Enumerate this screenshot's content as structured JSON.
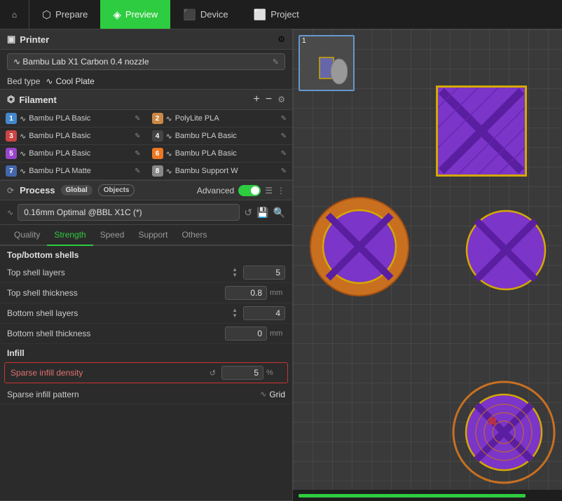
{
  "nav": {
    "home_icon": "⌂",
    "tabs": [
      {
        "label": "Prepare",
        "icon": "⬡",
        "active": false
      },
      {
        "label": "Preview",
        "icon": "◈",
        "active": true
      },
      {
        "label": "Device",
        "icon": "⬛",
        "active": false
      },
      {
        "label": "Project",
        "icon": "⬜",
        "active": false
      }
    ]
  },
  "printer": {
    "section_label": "Printer",
    "settings_icon": "⚙",
    "name": "Bambu Lab X1 Carbon 0.4 nozzle",
    "bed_type_label": "Bed type",
    "bed_value": "Cool Plate"
  },
  "filament": {
    "section_label": "Filament",
    "add_icon": "+",
    "remove_icon": "−",
    "settings_icon": "⚙",
    "items": [
      {
        "num": "1",
        "color": "#4488cc",
        "name": "Bambu PLA Basic"
      },
      {
        "num": "2",
        "color": "#cc8844",
        "name": "PolyLite PLA"
      },
      {
        "num": "3",
        "color": "#cc4444",
        "name": "Bambu PLA Basic"
      },
      {
        "num": "4",
        "color": "#444444",
        "name": "Bambu PLA Basic"
      },
      {
        "num": "5",
        "color": "#9944cc",
        "name": "Bambu PLA Basic"
      },
      {
        "num": "6",
        "color": "#ee7722",
        "name": "Bambu PLA Basic"
      },
      {
        "num": "7",
        "color": "#4466aa",
        "name": "Bambu PLA Matte"
      },
      {
        "num": "8",
        "color": "#888888",
        "name": "Bambu Support W"
      }
    ]
  },
  "process": {
    "section_label": "Process",
    "badge_global": "Global",
    "badge_objects": "Objects",
    "advanced_label": "Advanced",
    "profile": "0.16mm Optimal @BBL X1C (*)",
    "tabs": [
      {
        "label": "Quality",
        "active": false
      },
      {
        "label": "Strength",
        "active": true
      },
      {
        "label": "Speed",
        "active": false
      },
      {
        "label": "Support",
        "active": false
      },
      {
        "label": "Others",
        "active": false
      }
    ],
    "strength": {
      "topbottom_title": "Top/bottom shells",
      "top_shell_layers_label": "Top shell layers",
      "top_shell_layers_value": "5",
      "top_shell_thickness_label": "Top shell thickness",
      "top_shell_thickness_value": "0.8",
      "top_shell_thickness_unit": "mm",
      "bottom_shell_layers_label": "Bottom shell layers",
      "bottom_shell_layers_value": "4",
      "bottom_shell_thickness_label": "Bottom shell thickness",
      "bottom_shell_thickness_value": "0",
      "bottom_shell_thickness_unit": "mm",
      "infill_title": "Infill",
      "sparse_infill_density_label": "Sparse infill density",
      "sparse_infill_density_value": "5",
      "sparse_infill_density_unit": "%",
      "sparse_infill_pattern_label": "Sparse infill pattern",
      "sparse_infill_pattern_value": "Grid"
    }
  }
}
